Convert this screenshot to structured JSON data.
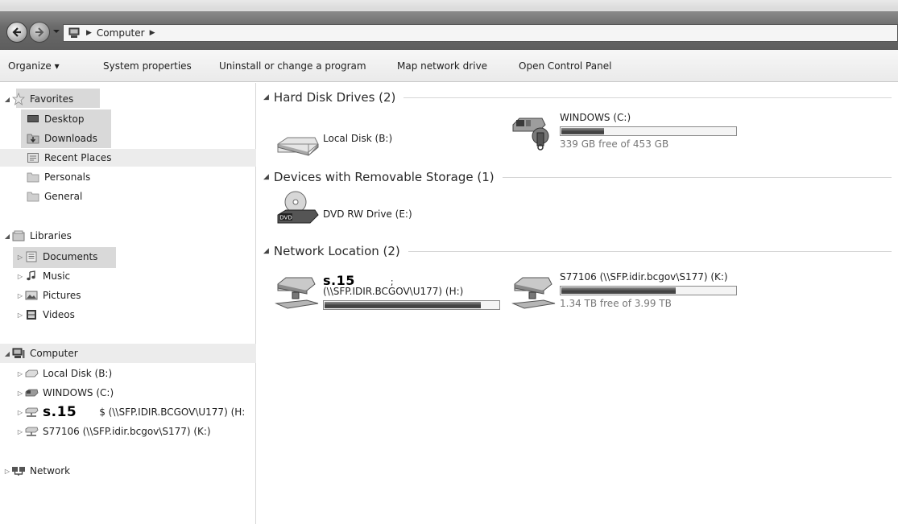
{
  "address_bar": {
    "location": "Computer"
  },
  "command_bar": {
    "organize": "Organize ▾",
    "system_properties": "System properties",
    "uninstall": "Uninstall or change a program",
    "map_network_drive": "Map network drive",
    "open_control_panel": "Open Control Panel"
  },
  "nav": {
    "favorites": "Favorites",
    "desktop": "Desktop",
    "downloads": "Downloads",
    "recent_places": "Recent Places",
    "personals": "Personals",
    "general": "General",
    "libraries": "Libraries",
    "documents": "Documents",
    "music": "Music",
    "pictures": "Pictures",
    "videos": "Videos",
    "computer": "Computer",
    "local_disk_b": "Local Disk (B:)",
    "windows_c": "WINDOWS (C:)",
    "h_redaction": "s.15",
    "h_drive": "$ (\\\\SFP.IDIR.BCGOV\\U177) (H:",
    "k_drive": "S77106 (\\\\SFP.idir.bcgov\\S177) (K:)",
    "network": "Network"
  },
  "content": {
    "groups": {
      "hard_disk": "Hard Disk Drives (2)",
      "removable": "Devices with Removable Storage (1)",
      "network": "Network Location (2)"
    },
    "drives": {
      "local_b": {
        "name": "Local Disk (B:)"
      },
      "windows_c": {
        "name": "WINDOWS (C:)",
        "free": "339 GB free of 453 GB",
        "used_fraction": 0.25
      },
      "dvd_e": {
        "name": "DVD RW Drive (E:)",
        "badge": "DVD"
      },
      "h_drive": {
        "redaction": "s.15",
        "redaction_tail": ";",
        "name": "(\\\\SFP.IDIR.BCGOV\\U177) (H:)",
        "used_fraction": 0.9
      },
      "k_drive": {
        "name": "S77106 (\\\\SFP.idir.bcgov\\S177) (K:)",
        "free": "1.34 TB free of 3.99 TB",
        "used_fraction": 0.66
      }
    }
  }
}
